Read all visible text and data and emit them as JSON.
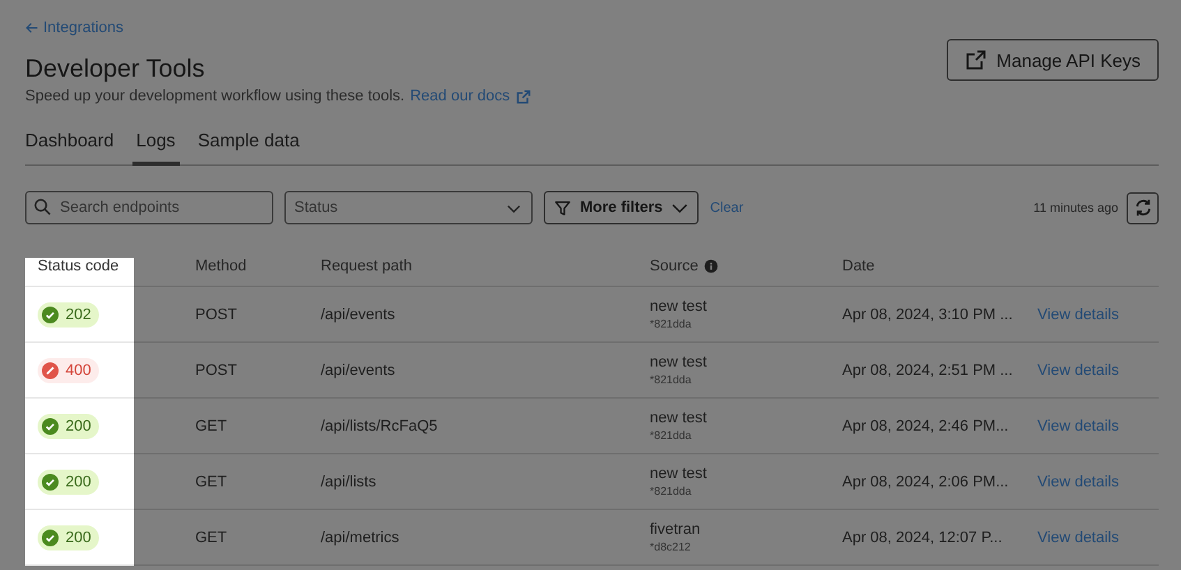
{
  "back_link": "Integrations",
  "page": {
    "title": "Developer Tools",
    "subtitle": "Speed up your development workflow using these tools.",
    "docs_link": "Read our docs"
  },
  "header_button": "Manage API Keys",
  "tabs": [
    {
      "label": "Dashboard",
      "selected": false
    },
    {
      "label": "Logs",
      "selected": true
    },
    {
      "label": "Sample data",
      "selected": false
    }
  ],
  "filters": {
    "search": {
      "placeholder": "Search endpoints"
    },
    "status": {
      "placeholder": "Status"
    },
    "more_filters": "More filters",
    "clear": "Clear",
    "updated": "11 minutes ago"
  },
  "table": {
    "columns": [
      "Status code",
      "Method",
      "Request path",
      "Source",
      "Date"
    ],
    "rows": [
      {
        "status": "202",
        "kind": "success",
        "method": "POST",
        "path": "/api/events",
        "source": "new test",
        "source_id": "*821dda",
        "date": "Apr 08, 2024, 3:10 PM ...",
        "action": "View details"
      },
      {
        "status": "400",
        "kind": "error",
        "method": "POST",
        "path": "/api/events",
        "source": "new test",
        "source_id": "*821dda",
        "date": "Apr 08, 2024, 2:51 PM ...",
        "action": "View details"
      },
      {
        "status": "200",
        "kind": "success",
        "method": "GET",
        "path": "/api/lists/RcFaQ5",
        "source": "new test",
        "source_id": "*821dda",
        "date": "Apr 08, 2024, 2:46 PM...",
        "action": "View details"
      },
      {
        "status": "200",
        "kind": "success",
        "method": "GET",
        "path": "/api/lists",
        "source": "new test",
        "source_id": "*821dda",
        "date": "Apr 08, 2024, 2:06 PM...",
        "action": "View details"
      },
      {
        "status": "200",
        "kind": "success",
        "method": "GET",
        "path": "/api/metrics",
        "source": "fivetran",
        "source_id": "*d8c212",
        "date": "Apr 08, 2024, 12:07 P...",
        "action": "View details"
      }
    ]
  }
}
